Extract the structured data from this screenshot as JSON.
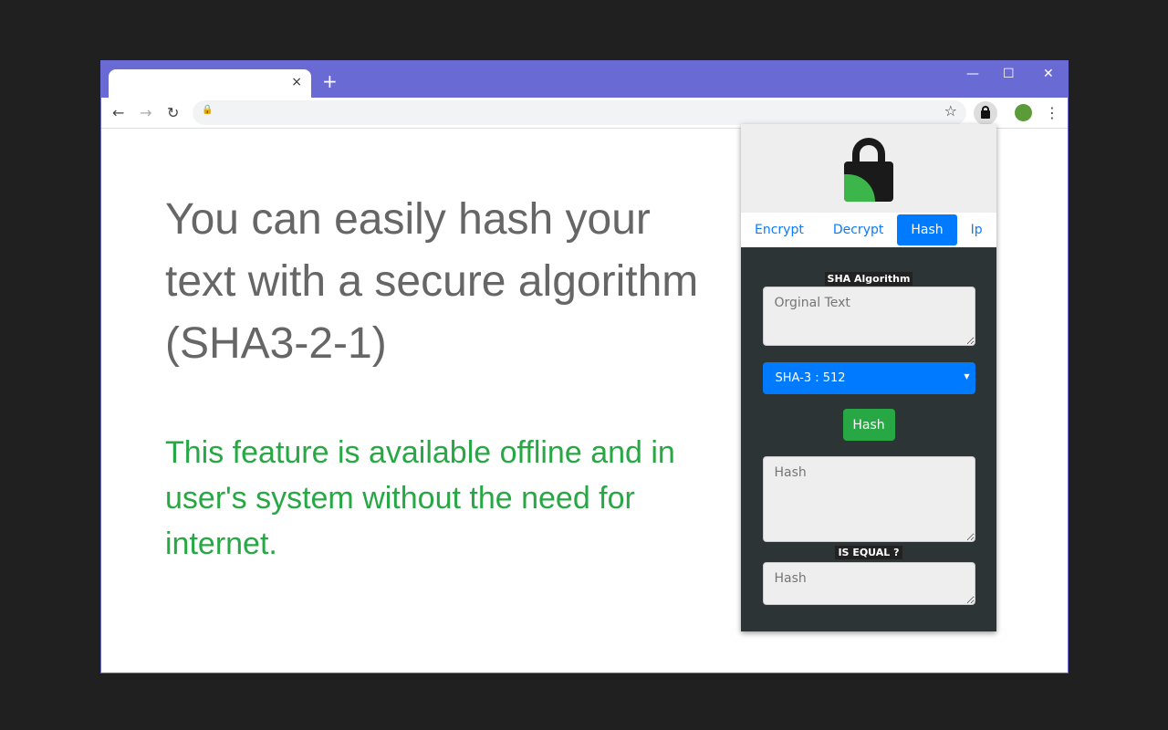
{
  "browser": {
    "tab_close": "×",
    "new_tab": "+",
    "minimize": "—",
    "maximize": "☐",
    "close": "✕",
    "back": "←",
    "forward": "→",
    "reload": "↻",
    "lock": "🔒",
    "star": "☆",
    "menu": "⋮"
  },
  "hero": {
    "headline": "You can easily hash your text with a secure algorithm (SHA3-2-1)",
    "subtext": "This feature is available offline and in user's system without the need for internet."
  },
  "popup": {
    "tabs": [
      {
        "label": "Encrypt"
      },
      {
        "label": "Decrypt"
      },
      {
        "label": "Hash",
        "active": true
      },
      {
        "label": "Ip"
      }
    ],
    "algo_label": "SHA Algorithm",
    "input_placeholder": "Orginal Text",
    "algo_selected": "SHA-3 : 512",
    "hash_button": "Hash",
    "output_placeholder": "Hash",
    "equal_label": "IS EQUAL ?",
    "compare_placeholder": "Hash"
  },
  "colors": {
    "titlebar": "#6a6ad4",
    "accent": "#007bff",
    "success": "#28a745",
    "panel": "#2d3436"
  }
}
